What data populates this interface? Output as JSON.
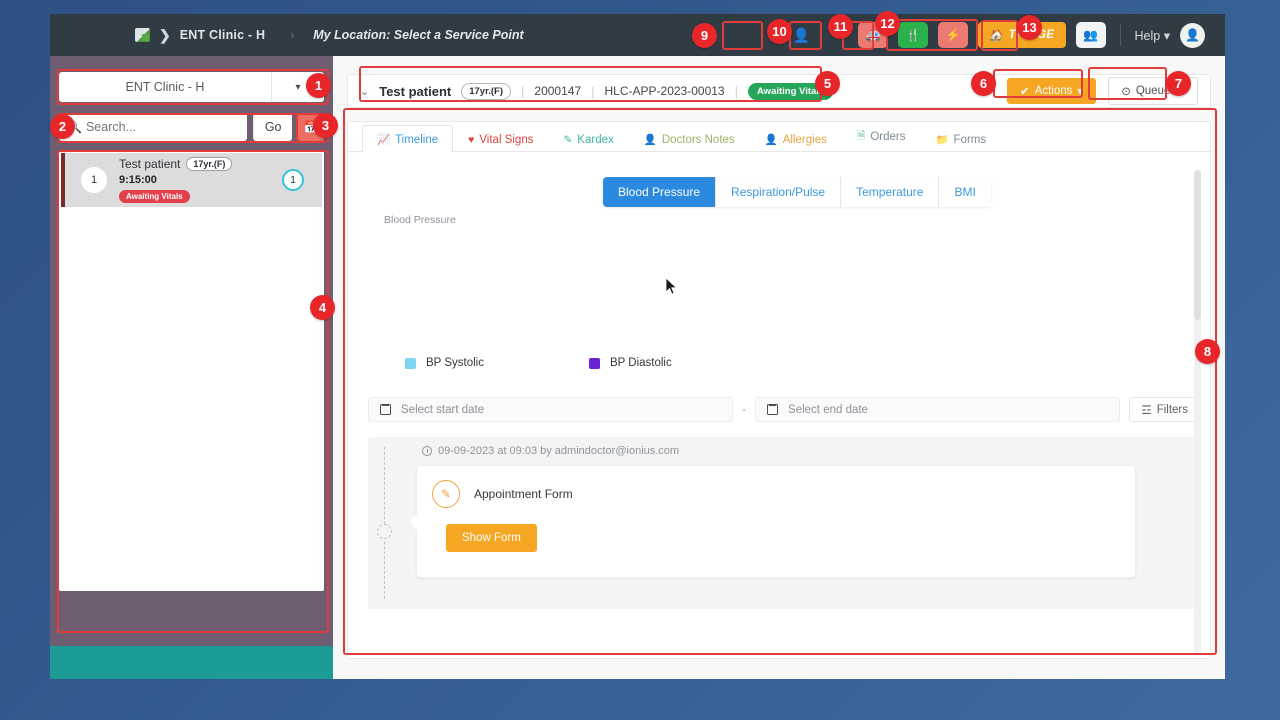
{
  "navbar": {
    "logo_icon": "clinic-logo-icon",
    "chevron_icon": "chevron-right-icon",
    "clinic_name": "ENT Clinic - H",
    "separator": "›",
    "location_label": "My Location: Select a Service Point",
    "user_ghost_icon": "user-icon",
    "icons": [
      {
        "name": "ambulance-icon",
        "glyph": "🚑",
        "style": "red"
      },
      {
        "name": "utensils-icon",
        "glyph": "🍴",
        "style": "green"
      },
      {
        "name": "bolt-icon",
        "glyph": "⚡",
        "style": "red"
      }
    ],
    "triage": {
      "label": "TRIAGE",
      "icon": "home-icon",
      "glyph": "🏠"
    },
    "people_icon": {
      "name": "people-group-icon",
      "glyph": "👥"
    },
    "help_label": "Help",
    "help_caret": "▾",
    "avatar_icon": "user-avatar-icon",
    "avatar_glyph": "👤"
  },
  "sidebar": {
    "clinic_select": {
      "value": "ENT Clinic - H",
      "caret": "▾"
    },
    "search": {
      "placeholder": "Search...",
      "value": "",
      "icon": "search-icon"
    },
    "go_label": "Go",
    "calendar_icon": "calendar-icon",
    "calendar_glyph": "📅",
    "patients": [
      {
        "queue_number": "1",
        "name": "Test patient",
        "age_sex": "17yr.(F)",
        "time": "9:15:00",
        "status": "Awaiting Vitals",
        "count": "1"
      }
    ]
  },
  "patient_header": {
    "caret_icon": "chevron-down-icon",
    "caret": "⌄",
    "name": "Test patient",
    "age_sex": "17yr.(F)",
    "pipe": "|",
    "mrn": "2000147",
    "appointment_id": "HLC-APP-2023-00013",
    "status_badge": "Awaiting Vitals",
    "actions_button": {
      "label": "Actions",
      "check_glyph": "✔",
      "caret": "▾"
    },
    "queue_button": {
      "label": "Queue",
      "clock_glyph": "⊙",
      "caret": "⌄"
    }
  },
  "tabs": [
    {
      "label": "Timeline",
      "icon": "chart-line-icon",
      "glyph": "📈",
      "active": true,
      "color": "#3c9ae0"
    },
    {
      "label": "Vital Signs",
      "icon": "heartbeat-icon",
      "glyph": "♥",
      "active": false,
      "color": "#e2443c"
    },
    {
      "label": "Kardex",
      "icon": "edit-icon",
      "glyph": "✎",
      "active": false,
      "color": "#41b3a3"
    },
    {
      "label": "Doctors Notes",
      "icon": "user-md-icon",
      "glyph": "👤",
      "active": false,
      "color": "#88b04b"
    },
    {
      "label": "Allergies",
      "icon": "allergy-icon",
      "glyph": "👤",
      "active": false,
      "color": "#f0a020"
    },
    {
      "label": "Orders",
      "icon": "file-icon",
      "glyph": "🗎",
      "active": false,
      "color": "#7ab8a0"
    },
    {
      "label": "Forms",
      "icon": "folder-icon",
      "glyph": "📁",
      "active": false,
      "color": "#3b7bbf"
    }
  ],
  "chart_segments": [
    {
      "label": "Blood Pressure",
      "active": true
    },
    {
      "label": "Respiration/Pulse",
      "active": false
    },
    {
      "label": "Temperature",
      "active": false
    },
    {
      "label": "BMI",
      "active": false
    }
  ],
  "chart_data": {
    "type": "line",
    "title": "Blood Pressure",
    "xlabel": "",
    "ylabel": "",
    "x": [],
    "series": [
      {
        "name": "BP Systolic",
        "values": [],
        "color": "#7fd4f0"
      },
      {
        "name": "BP Diastolic",
        "values": [],
        "color": "#6b21d6"
      }
    ],
    "legend_position": "bottom-left",
    "grid": false,
    "note": "No data points plotted — empty chart area"
  },
  "date_filter": {
    "start_placeholder": "Select start date",
    "end_placeholder": "Select end date",
    "start_value": "",
    "end_value": "",
    "separator": "-",
    "calendar_icon": "calendar-icon",
    "filters_button": {
      "label": "Filters",
      "icon": "sliders-icon",
      "glyph": "☲"
    }
  },
  "timeline": {
    "entries": [
      {
        "meta": "09-09-2023 at 09:03 by admindoctor@ionius.com",
        "clock_icon": "clock-icon",
        "form_icon": "form-edit-icon",
        "form_glyph": "✎",
        "form_name": "Appointment Form",
        "button_label": "Show Form"
      }
    ]
  },
  "scrollbar": {
    "name": "vertical-scrollbar"
  },
  "annotations": [
    {
      "number": "1",
      "target": "clinic-select"
    },
    {
      "number": "2",
      "target": "search-input"
    },
    {
      "number": "3",
      "target": "calendar-button"
    },
    {
      "number": "4",
      "target": "patient-list"
    },
    {
      "number": "5",
      "target": "patient-header"
    },
    {
      "number": "6",
      "target": "actions-button"
    },
    {
      "number": "7",
      "target": "queue-button"
    },
    {
      "number": "8",
      "target": "content-panel"
    },
    {
      "number": "9",
      "target": "ambulance-icon-button"
    },
    {
      "number": "10",
      "target": "utensils-icon-button"
    },
    {
      "number": "11",
      "target": "bolt-icon-button"
    },
    {
      "number": "12",
      "target": "triage-button"
    },
    {
      "number": "13",
      "target": "people-icon-button"
    }
  ]
}
